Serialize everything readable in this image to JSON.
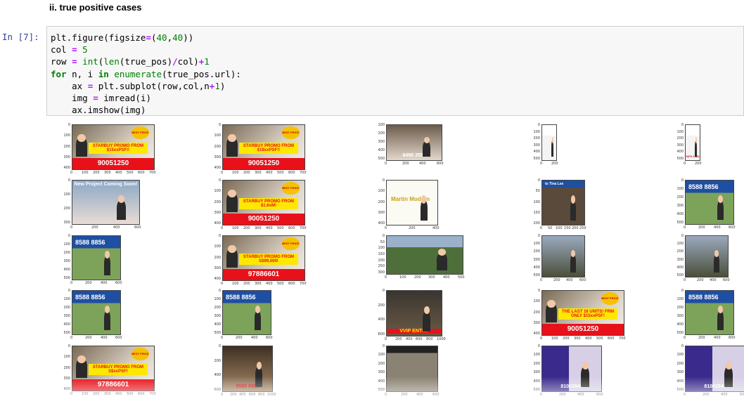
{
  "heading": "ii. true positive cases",
  "prompt": "In [7]:",
  "code": {
    "lines": [
      "plt.figure(figsize=(40,40))",
      "col = 5",
      "row = int(len(true_pos)/col)+1",
      "for n, i in enumerate(true_pos.url):",
      "    ax = plt.subplot(row,col,n+1)",
      "    img = imread(i)",
      "    ax.imshow(img)"
    ]
  },
  "grid": {
    "cells": [
      {
        "type": "starbuy",
        "banner": "90051250",
        "promo": "STARBUY PROMO FROM $15xxPSF!!",
        "badge": "BEST PRICE",
        "yt": [
          "0",
          "100",
          "200",
          "300",
          "400"
        ],
        "xt": [
          "0",
          "100",
          "200",
          "300",
          "400",
          "500",
          "600",
          "700"
        ]
      },
      {
        "type": "starbuy",
        "banner": "90051250",
        "promo": "STARBUY PROMO FROM $18xxPSF!!",
        "badge": "BEST PRICE",
        "yt": [
          "0",
          "100",
          "200",
          "300",
          "400"
        ],
        "xt": [
          "0",
          "100",
          "200",
          "300",
          "400",
          "500",
          "600",
          "700"
        ]
      },
      {
        "type": "agent",
        "banner": "8498 3553",
        "promo": "",
        "badge": "",
        "yt": [
          "100",
          "200",
          "300",
          "400",
          "500"
        ],
        "xt": [
          "0",
          "200",
          "400",
          "600"
        ]
      },
      {
        "type": "card",
        "banner": "",
        "promo": "",
        "badge": "",
        "yt": [
          "0",
          "100",
          "200",
          "300",
          "400",
          "500"
        ],
        "xt": [
          "0",
          "200"
        ]
      },
      {
        "type": "card",
        "banner": "9474 1682",
        "promo": "",
        "badge": "",
        "yt": [
          "0",
          "100",
          "200",
          "300",
          "400",
          "500"
        ],
        "xt": [
          "0",
          "200"
        ]
      },
      {
        "type": "project",
        "banner": "New Project Coming Soon!",
        "promo": "",
        "badge": "",
        "yt": [
          "0",
          "100",
          "200",
          "300"
        ],
        "xt": [
          "0",
          "200",
          "400",
          "600"
        ]
      },
      {
        "type": "starbuy",
        "banner": "90051250",
        "promo": "STARBUY PROMO FROM $1.6xM!",
        "badge": "BEST PRICE",
        "yt": [
          "0",
          "100",
          "200",
          "300",
          "400"
        ],
        "xt": [
          "0",
          "100",
          "200",
          "300",
          "400",
          "500",
          "600",
          "700"
        ]
      },
      {
        "type": "martin",
        "banner": "Martin Modern",
        "promo": "",
        "badge": "",
        "yt": [
          "0",
          "100",
          "200",
          "300",
          "400"
        ],
        "xt": [
          "0",
          "200",
          "400"
        ]
      },
      {
        "type": "tina",
        "banner": "to Tina Lee",
        "promo": "",
        "badge": "",
        "yt": [
          "0",
          "50",
          "100",
          "150",
          "200"
        ],
        "xt": [
          "0",
          "50",
          "100",
          "150",
          "200",
          "250"
        ]
      },
      {
        "type": "dev",
        "banner": "8588 8856",
        "promo": "",
        "badge": "",
        "yt": [
          "0",
          "100",
          "200",
          "300",
          "400",
          "500"
        ],
        "xt": [
          "0",
          "200",
          "400",
          "600"
        ]
      },
      {
        "type": "dev",
        "banner": "8588 8856",
        "promo": "",
        "badge": "",
        "yt": [
          "0",
          "100",
          "200",
          "300",
          "400",
          "500"
        ],
        "xt": [
          "0",
          "200",
          "400",
          "600"
        ]
      },
      {
        "type": "starbuy",
        "banner": "97886601",
        "promo": "STARBUY PROMO FROM S$99,000!",
        "badge": "BEST PRICE",
        "yt": [
          "0",
          "100",
          "200",
          "300",
          "400"
        ],
        "xt": [
          "0",
          "100",
          "200",
          "300",
          "400",
          "500",
          "600",
          "700"
        ]
      },
      {
        "type": "aerial",
        "banner": "",
        "promo": "",
        "badge": "",
        "yt": [
          "0",
          "50",
          "100",
          "150",
          "200",
          "250",
          "300"
        ],
        "xt": [
          "0",
          "100",
          "200",
          "300",
          "400",
          "500"
        ]
      },
      {
        "type": "tower",
        "banner": "",
        "promo": "",
        "badge": "",
        "yt": [
          "0",
          "100",
          "200",
          "300",
          "400",
          "500"
        ],
        "xt": [
          "0",
          "200",
          "400",
          "600"
        ]
      },
      {
        "type": "tower",
        "banner": "",
        "promo": "",
        "badge": "",
        "yt": [
          "0",
          "100",
          "200",
          "300",
          "400",
          "500"
        ],
        "xt": [
          "0",
          "200",
          "400",
          "600"
        ]
      },
      {
        "type": "dev",
        "banner": "8588 8856",
        "promo": "",
        "badge": "",
        "yt": [
          "0",
          "100",
          "200",
          "300",
          "400",
          "500"
        ],
        "xt": [
          "0",
          "200",
          "400",
          "600"
        ]
      },
      {
        "type": "dev",
        "banner": "8588 8856",
        "promo": "",
        "badge": "",
        "yt": [
          "0",
          "100",
          "200",
          "300",
          "400",
          "500"
        ],
        "xt": [
          "0",
          "200",
          "400",
          "600"
        ]
      },
      {
        "type": "vvip",
        "banner": "VVIP ENTRY",
        "promo": "",
        "badge": "",
        "yt": [
          "0",
          "200",
          "400",
          "600"
        ],
        "xt": [
          "0",
          "200",
          "400",
          "600",
          "800",
          "1000"
        ]
      },
      {
        "type": "starbuy",
        "banner": "90051250",
        "promo": "THE LAST 16 UNITS! FRM ONLY $15xxPSF!",
        "badge": "BEST PRICE",
        "yt": [
          "0",
          "100",
          "200",
          "300",
          "400"
        ],
        "xt": [
          "0",
          "100",
          "200",
          "300",
          "400",
          "500",
          "600",
          "700"
        ]
      },
      {
        "type": "dev",
        "banner": "8588 8856",
        "promo": "",
        "badge": "",
        "yt": [
          "0",
          "100",
          "200",
          "300",
          "400",
          "500"
        ],
        "xt": [
          "0",
          "200",
          "400",
          "600"
        ]
      },
      {
        "type": "starbuy",
        "banner": "97886601",
        "promo": "STARBUY PROMO FROM S$xxPSF!",
        "badge": "BEST PRICE",
        "yt": [
          "0",
          "100",
          "200",
          "300",
          "400"
        ],
        "xt": [
          "0",
          "100",
          "200",
          "300",
          "400",
          "500",
          "600",
          "700"
        ]
      },
      {
        "type": "interior",
        "banner": "8588 8856",
        "promo": "",
        "badge": "",
        "yt": [
          "0",
          "200",
          "400",
          "600"
        ],
        "xt": [
          "0",
          "200",
          "400",
          "600",
          "800",
          "1000"
        ]
      },
      {
        "type": "waverly",
        "banner": "",
        "promo": "",
        "badge": "",
        "yt": [
          "0",
          "100",
          "200",
          "300",
          "400",
          "500"
        ],
        "xt": [
          "0",
          "200",
          "400",
          "600"
        ]
      },
      {
        "type": "purple",
        "banner": "81003946",
        "promo": "",
        "badge": "",
        "yt": [
          "0",
          "100",
          "200",
          "300",
          "400",
          "500"
        ],
        "xt": [
          "0",
          "200",
          "400",
          "600"
        ]
      },
      {
        "type": "purple",
        "banner": "81003946",
        "promo": "",
        "badge": "",
        "yt": [
          "0",
          "100",
          "200",
          "300",
          "400",
          "500"
        ],
        "xt": [
          "0",
          "200",
          "400",
          "600"
        ]
      }
    ]
  },
  "colors": {
    "prompt": "#303f9f",
    "keyword": "#008000",
    "operator": "#aa22ff",
    "banner_red": "#e8111a",
    "promo_yellow": "#ffe800",
    "dev_blue": "#1e4fa3",
    "purple": "#3a2a8c"
  }
}
